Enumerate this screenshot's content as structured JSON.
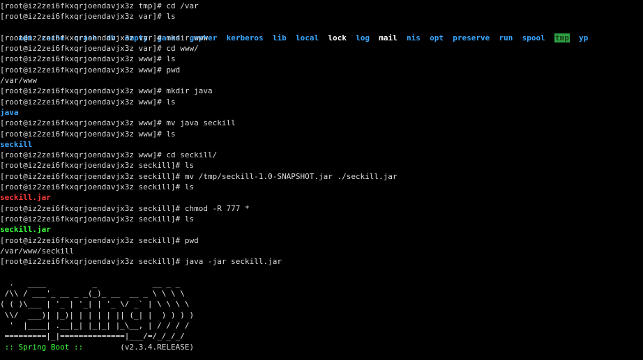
{
  "terminal": {
    "lines": [
      "[root@iz2zei6fkxqrjoendavjx3z tmp]# cd /var",
      "[root@iz2zei6fkxqrjoendavjx3z var]# ls",
      "",
      "[root@iz2zei6fkxqrjoendavjx3z var]# mkdir www",
      "[root@iz2zei6fkxqrjoendavjx3z var]# cd www/",
      "[root@iz2zei6fkxqrjoendavjx3z www]# ls",
      "[root@iz2zei6fkxqrjoendavjx3z www]# pwd",
      "/var/www",
      "[root@iz2zei6fkxqrjoendavjx3z www]# mkdir java",
      "[root@iz2zei6fkxqrjoendavjx3z www]# ls",
      "java",
      "[root@iz2zei6fkxqrjoendavjx3z www]# mv java seckill",
      "[root@iz2zei6fkxqrjoendavjx3z www]# ls",
      "seckill",
      "[root@iz2zei6fkxqrjoendavjx3z www]# cd seckill/",
      "[root@iz2zei6fkxqrjoendavjx3z seckill]# ls",
      "[root@iz2zei6fkxqrjoendavjx3z seckill]# mv /tmp/seckill-1.0-SNAPSHOT.jar ./seckill.jar",
      "[root@iz2zei6fkxqrjoendavjx3z seckill]# ls",
      "seckill.jar",
      "[root@iz2zei6fkxqrjoendavjx3z seckill]# chmod -R 777 *",
      "[root@iz2zei6fkxqrjoendavjx3z seckill]# ls",
      "seckill.jar",
      "[root@iz2zei6fkxqrjoendavjx3z seckill]# pwd",
      "/var/www/seckill",
      "[root@iz2zei6fkxqrjoendavjx3z seckill]# java -jar seckill.jar"
    ],
    "ls_var": [
      "adm",
      "cache",
      "crash",
      "db",
      "empty",
      "games",
      "gopher",
      "kerberos",
      "lib",
      "local",
      "lock",
      "log",
      "mail",
      "nis",
      "opt",
      "preserve",
      "run",
      "spool",
      "tmp",
      "yp"
    ],
    "banner": [
      "  .   ____          _            __ _ _",
      " /\\\\ / ___'_ __ _ _(_)_ __  __ _ \\ \\ \\ \\",
      "( ( )\\___ | '_ | '_| | '_ \\/ _` | \\ \\ \\ \\",
      " \\\\/  ___)| |_)| | | | | || (_| |  ) ) ) )",
      "  '  |____| .__|_| |_|_| |_\\__, | / / / /",
      " =========|_|==============|___/=/_/_/_/"
    ],
    "spring_label": " :: Spring Boot :: ",
    "spring_version": "       (v2.3.4.RELEASE)"
  },
  "colors": {
    "background": "#000000",
    "text": "#dcdcdc",
    "directory": "#3aa7ff",
    "executable": "#3cff3c",
    "archive": "#ff3b3b",
    "sticky_dir_bg": "#2ea043"
  }
}
